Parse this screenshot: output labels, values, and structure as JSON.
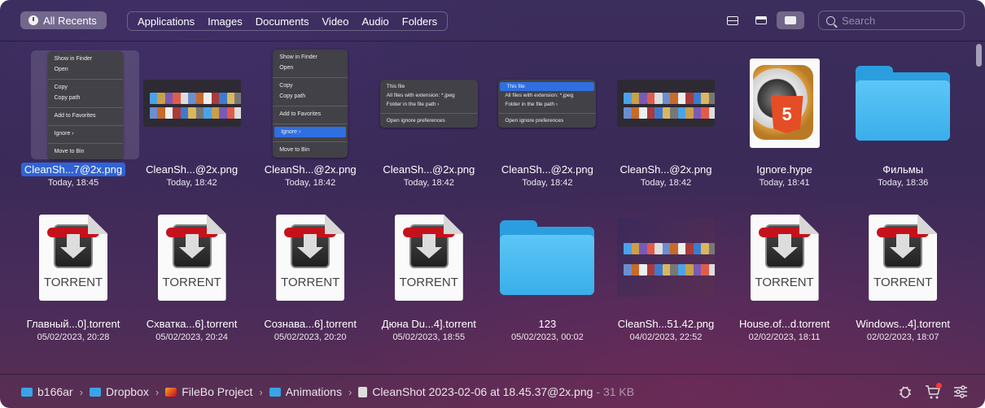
{
  "toolbar": {
    "all_recents": "All Recents",
    "filters": [
      "Applications",
      "Images",
      "Documents",
      "Video",
      "Audio",
      "Folders"
    ],
    "search_placeholder": "Search"
  },
  "files": [
    {
      "name": "CleanSh...7@2x.png",
      "date": "Today, 18:45",
      "kind": "menu1",
      "selected": true
    },
    {
      "name": "CleanSh...@2x.png",
      "date": "Today, 18:42",
      "kind": "shot"
    },
    {
      "name": "CleanSh...@2x.png",
      "date": "Today, 18:42",
      "kind": "menu2"
    },
    {
      "name": "CleanSh...@2x.png",
      "date": "Today, 18:42",
      "kind": "menu3"
    },
    {
      "name": "CleanSh...@2x.png",
      "date": "Today, 18:42",
      "kind": "menu4"
    },
    {
      "name": "CleanSh...@2x.png",
      "date": "Today, 18:42",
      "kind": "shot"
    },
    {
      "name": "Ignore.hype",
      "date": "Today, 18:41",
      "kind": "hype"
    },
    {
      "name": "Фильмы",
      "date": "Today, 18:36",
      "kind": "folder"
    },
    {
      "name": "Главный...0].torrent",
      "date": "05/02/2023, 20:28",
      "kind": "torrent"
    },
    {
      "name": "Схватка...6].torrent",
      "date": "05/02/2023, 20:24",
      "kind": "torrent"
    },
    {
      "name": "Сознава...6].torrent",
      "date": "05/02/2023, 20:20",
      "kind": "torrent"
    },
    {
      "name": "Дюна Du...4].torrent",
      "date": "05/02/2023, 18:55",
      "kind": "torrent"
    },
    {
      "name": "123",
      "date": "05/02/2023, 00:02",
      "kind": "folder"
    },
    {
      "name": "CleanSh...51.42.png",
      "date": "04/02/2023, 22:52",
      "kind": "shot2"
    },
    {
      "name": "House.of...d.torrent",
      "date": "02/02/2023, 18:11",
      "kind": "torrent"
    },
    {
      "name": "Windows...4].torrent",
      "date": "02/02/2023, 18:07",
      "kind": "torrent"
    }
  ],
  "context_menu_1": [
    "Show in Finder",
    "Open",
    "Copy",
    "Copy path",
    "Add to Favorites",
    "Ignore",
    "Move to Bin"
  ],
  "context_menu_2": [
    "This file",
    "All files with extension: *.jpeg",
    "Folder in the file path",
    "Open ignore preferences"
  ],
  "torrent_label": "TORRENT",
  "html5_label": "5",
  "status": {
    "crumbs": [
      "b166ar",
      "Dropbox",
      "FileBo Project",
      "Animations",
      "CleanShot 2023-02-06 at 18.45.37@2x.png"
    ],
    "size": "- 31 KB"
  },
  "colors": {
    "accent": "#2f63d6",
    "folder": "#3aaeea",
    "torrent_red": "#c4121c",
    "badge": "#ff3b30"
  }
}
